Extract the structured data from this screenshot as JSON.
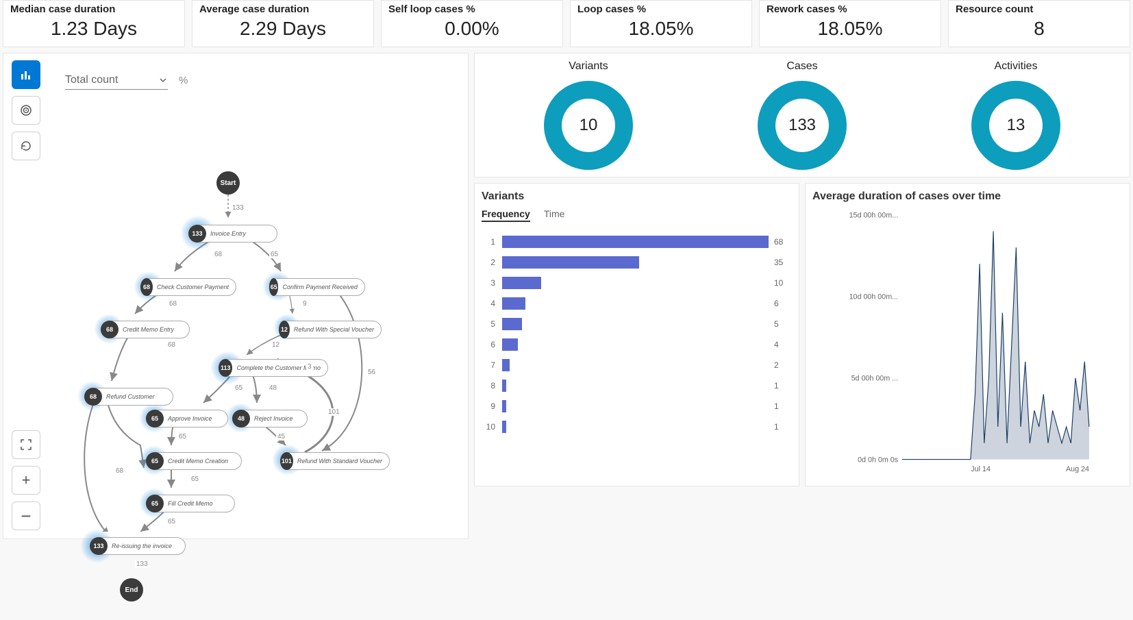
{
  "kpis": [
    {
      "title": "Median case duration",
      "value": "1.23 Days"
    },
    {
      "title": "Average case duration",
      "value": "2.29 Days"
    },
    {
      "title": "Self loop cases %",
      "value": "0.00%"
    },
    {
      "title": "Loop cases %",
      "value": "18.05%"
    },
    {
      "title": "Rework cases %",
      "value": "18.05%"
    },
    {
      "title": "Resource count",
      "value": "8"
    }
  ],
  "flow": {
    "dropdown_label": "Total count",
    "percent_symbol": "%",
    "start_label": "Start",
    "end_label": "End",
    "nodes": [
      {
        "id": "invoice_entry",
        "count": "133",
        "label": "Invoice Entry"
      },
      {
        "id": "check_customer_payment",
        "count": "68",
        "label": "Check Customer Payment"
      },
      {
        "id": "confirm_payment_received",
        "count": "65",
        "label": "Confirm Payment Received"
      },
      {
        "id": "credit_memo_entry",
        "count": "68",
        "label": "Credit Memo Entry"
      },
      {
        "id": "refund_with_special_voucher",
        "count": "12",
        "label": "Refund With Special Voucher"
      },
      {
        "id": "complete_customer_memo",
        "count": "113",
        "label": "Complete the Customer Memo"
      },
      {
        "id": "refund_customer",
        "count": "68",
        "label": "Refund Customer"
      },
      {
        "id": "approve_invoice",
        "count": "65",
        "label": "Approve Invoice"
      },
      {
        "id": "reject_invoice",
        "count": "48",
        "label": "Reject Invoice"
      },
      {
        "id": "credit_memo_creation",
        "count": "65",
        "label": "Credit Memo Creation"
      },
      {
        "id": "refund_with_standard_voucher",
        "count": "101",
        "label": "Refund With Standard Voucher"
      },
      {
        "id": "fill_credit_memo",
        "count": "65",
        "label": "Fill Credit Memo"
      },
      {
        "id": "reissuing_invoice",
        "count": "133",
        "label": "Re-issuing the invoice"
      }
    ],
    "edges": {
      "start_invoice": "133",
      "invoice_check": "68",
      "invoice_confirm": "65",
      "check_credit": "68",
      "confirm_refundsp": "9",
      "refundsp_complete": "12",
      "credit_refundcust": "68",
      "complete_approve": "65",
      "complete_reject": "48",
      "complete_self": "3",
      "approve_creation": "65",
      "reject_refundstd": "45",
      "refundstd_complete": "101",
      "creation_fill": "65",
      "fill_reissue": "65",
      "refundcust_reissue": "68",
      "confirm_refundstd": "56",
      "reissue_end": "133"
    }
  },
  "donuts": {
    "variants": {
      "title": "Variants",
      "value": "10"
    },
    "cases": {
      "title": "Cases",
      "value": "133"
    },
    "activities": {
      "title": "Activities",
      "value": "13"
    }
  },
  "variants_panel": {
    "title": "Variants",
    "tabs": {
      "frequency": "Frequency",
      "time": "Time"
    }
  },
  "chart_data": [
    {
      "type": "bar",
      "title": "Variants (Frequency)",
      "categories": [
        "1",
        "2",
        "3",
        "4",
        "5",
        "6",
        "7",
        "8",
        "9",
        "10"
      ],
      "values": [
        68,
        35,
        10,
        6,
        5,
        4,
        2,
        1,
        1,
        1
      ],
      "xlim": [
        0,
        68
      ]
    },
    {
      "type": "area",
      "title": "Average duration of cases over time",
      "ylabel": "",
      "yticks": [
        "0d 0h 0m 0s",
        "5d 00h 00m ...",
        "10d 00h 00m...",
        "15d 00h 00m..."
      ],
      "ylim": [
        0,
        15
      ],
      "x_range_labels": [
        "Jul 14",
        "Aug 24"
      ],
      "x": [
        0,
        1,
        2,
        3,
        4,
        5,
        6,
        7,
        8,
        9,
        10,
        11,
        12,
        13,
        14,
        15,
        16,
        17,
        18,
        19,
        20,
        21,
        22,
        23,
        24,
        25,
        26,
        27,
        28,
        29,
        30,
        31,
        32,
        33,
        34,
        35,
        36,
        37,
        38,
        39,
        40,
        41
      ],
      "values": [
        0,
        0,
        0,
        0,
        0,
        0,
        0,
        0,
        0,
        0,
        0,
        0,
        0,
        0,
        0,
        0,
        4,
        12,
        1,
        5,
        14,
        2,
        9,
        1,
        7,
        13,
        2,
        6,
        1,
        3,
        2,
        4,
        1,
        3,
        2,
        1,
        2,
        1,
        5,
        3,
        6,
        2
      ]
    }
  ],
  "line_panel": {
    "title": "Average duration of cases over time"
  }
}
